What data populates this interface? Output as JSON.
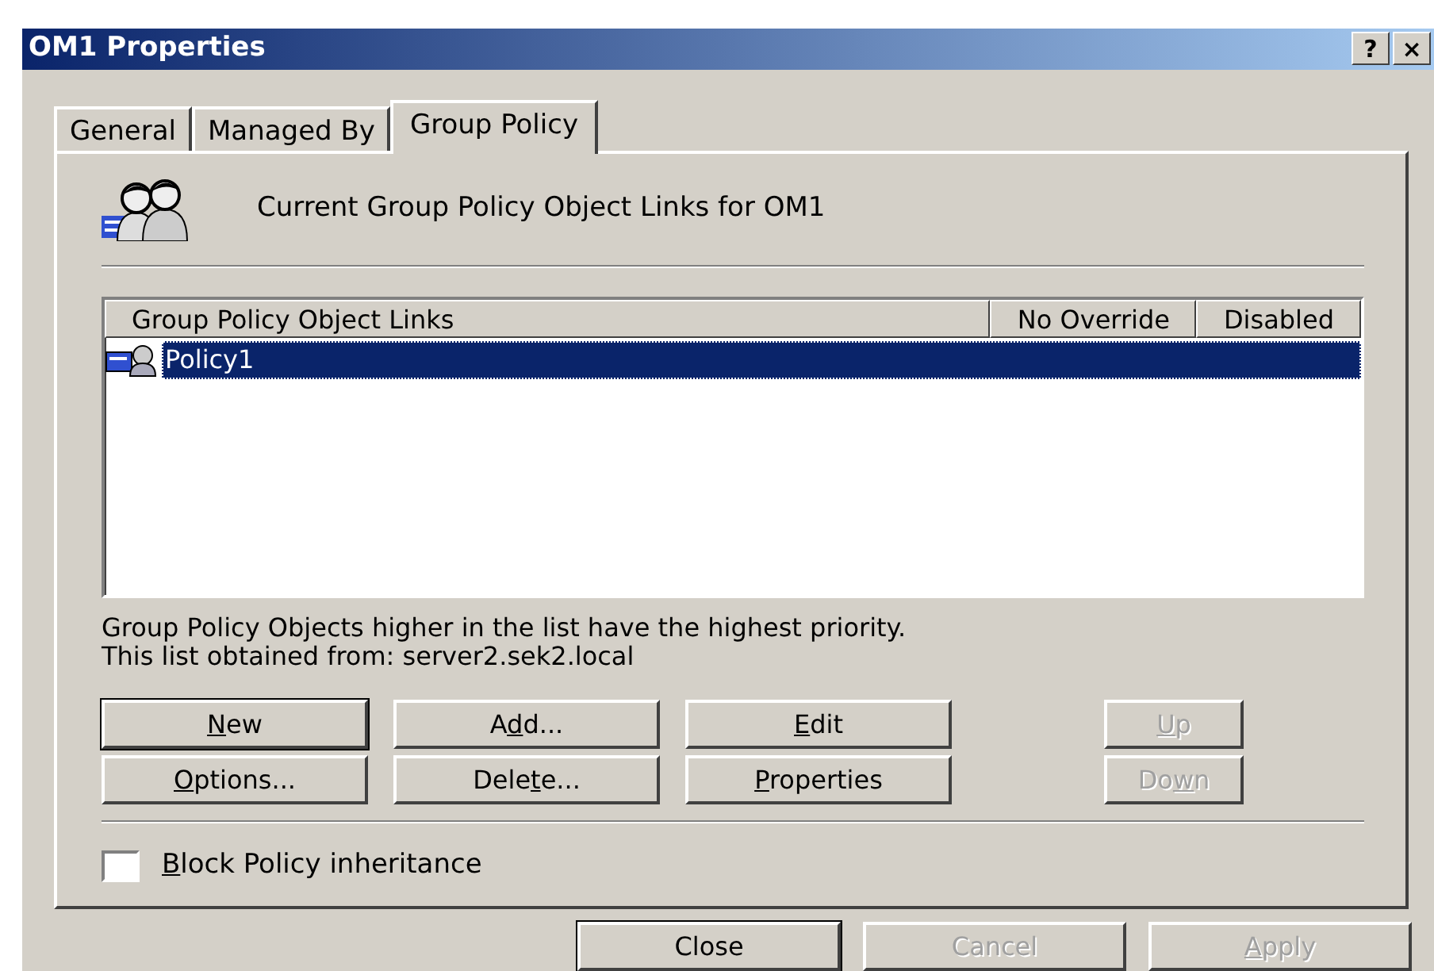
{
  "window": {
    "title": "OM1 Properties",
    "title_buttons": [
      "?",
      "×"
    ]
  },
  "tabs": [
    {
      "label": "General",
      "selected": false
    },
    {
      "label": "Managed By",
      "selected": false
    },
    {
      "label": "Group Policy",
      "selected": true
    }
  ],
  "header": "Current Group Policy Object Links for OM1",
  "table": {
    "columns": [
      "Group Policy Object Links",
      "No Override",
      "Disabled"
    ],
    "rows": [
      {
        "name": "Policy1",
        "selected": true
      }
    ]
  },
  "notes": [
    "Group Policy Objects higher in the list have the highest priority.",
    "This list obtained from: server2.sek2.local"
  ],
  "buttons": [
    {
      "key": "N",
      "post": "ew",
      "disabled": false,
      "default": true
    },
    {
      "pre": "A",
      "key": "d",
      "post": "d...",
      "disabled": false,
      "default": false
    },
    {
      "key": "E",
      "post": "dit",
      "disabled": false,
      "default": false
    },
    {
      "key": "U",
      "post": "p",
      "disabled": true,
      "default": false
    },
    {
      "key": "O",
      "post": "ptions...",
      "disabled": false,
      "default": false
    },
    {
      "pre": "Dele",
      "key": "t",
      "post": "e...",
      "disabled": false,
      "default": false
    },
    {
      "key": "P",
      "post": "roperties",
      "disabled": false,
      "default": false
    },
    {
      "pre": "Do",
      "key": "w",
      "post": "n",
      "disabled": true,
      "default": false
    }
  ],
  "block_inheritance": {
    "key": "B",
    "post": "lock Policy inheritance",
    "checked": false
  },
  "footer_buttons": [
    {
      "post": "Close",
      "disabled": false,
      "default": true
    },
    {
      "post": "Cancel",
      "disabled": true,
      "default": false
    },
    {
      "key": "A",
      "post": "pply",
      "disabled": true,
      "default": false
    }
  ]
}
